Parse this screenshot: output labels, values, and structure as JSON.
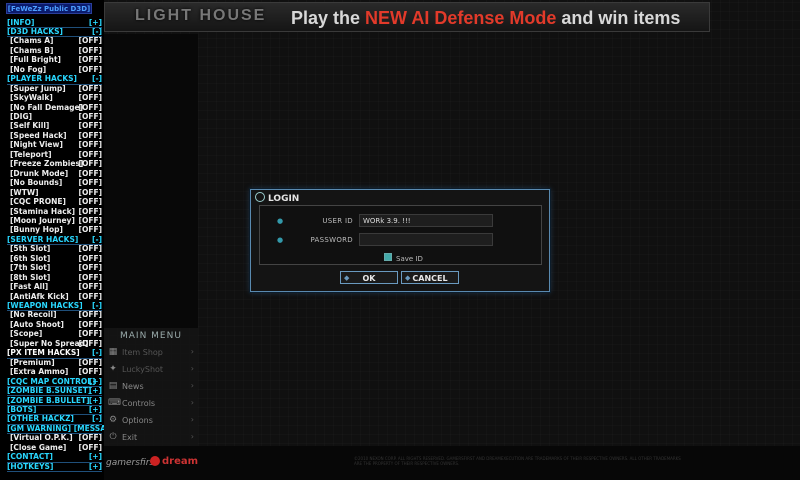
{
  "banner": {
    "logo_text": "LIGHT HOUSE",
    "text_pre": "Play the ",
    "text_hl": "NEW AI Defense Mode",
    "text_post": " and win items"
  },
  "cheat_menu": {
    "title": "[FeWeZz Public D3D]",
    "rows": [
      {
        "kind": "sec",
        "label": "[INFO]",
        "state": "[+]"
      },
      {
        "kind": "sec",
        "label": "[D3D HACKS]",
        "state": "[-]"
      },
      {
        "kind": "item",
        "label": "[Chams A]",
        "state": "[OFF]"
      },
      {
        "kind": "item",
        "label": "[Chams B]",
        "state": "[OFF]"
      },
      {
        "kind": "item",
        "label": "[Full Bright]",
        "state": "[OFF]"
      },
      {
        "kind": "item",
        "label": "[No Fog]",
        "state": "[OFF]"
      },
      {
        "kind": "sec",
        "label": "[PLAYER HACKS]",
        "state": "[-]"
      },
      {
        "kind": "item",
        "label": "[Super Jump]",
        "state": "[OFF]"
      },
      {
        "kind": "item",
        "label": "[SkyWalk]",
        "state": "[OFF]"
      },
      {
        "kind": "item",
        "label": "[No Fall Demage]",
        "state": "[OFF]"
      },
      {
        "kind": "item",
        "label": "[DIG]",
        "state": "[OFF]"
      },
      {
        "kind": "item",
        "label": "[Self Kill]",
        "state": "[OFF]"
      },
      {
        "kind": "item",
        "label": "[Speed Hack]",
        "state": "[OFF]"
      },
      {
        "kind": "item",
        "label": "[Night View]",
        "state": "[OFF]"
      },
      {
        "kind": "item",
        "label": "[Teleport]",
        "state": "[OFF]"
      },
      {
        "kind": "item",
        "label": "[Freeze Zombies]",
        "state": "[OFF]"
      },
      {
        "kind": "item",
        "label": "[Drunk Mode]",
        "state": "[OFF]"
      },
      {
        "kind": "item",
        "label": "[No Bounds]",
        "state": "[OFF]"
      },
      {
        "kind": "item",
        "label": "[WTW]",
        "state": "[OFF]"
      },
      {
        "kind": "item",
        "label": "[CQC PRONE]",
        "state": "[OFF]"
      },
      {
        "kind": "item",
        "label": "[Stamina Hack]",
        "state": "[OFF]"
      },
      {
        "kind": "item",
        "label": "[Moon Journey]",
        "state": "[OFF]"
      },
      {
        "kind": "item",
        "label": "[Bunny Hop]",
        "state": "[OFF]"
      },
      {
        "kind": "sec",
        "label": "[SERVER HACKS]",
        "state": "[-]"
      },
      {
        "kind": "item",
        "label": "[5th Slot]",
        "state": "[OFF]"
      },
      {
        "kind": "item",
        "label": "[6th Slot]",
        "state": "[OFF]"
      },
      {
        "kind": "item",
        "label": "[7th Slot]",
        "state": "[OFF]"
      },
      {
        "kind": "item",
        "label": "[8th Slot]",
        "state": "[OFF]"
      },
      {
        "kind": "item",
        "label": "[Fast All]",
        "state": "[OFF]"
      },
      {
        "kind": "item",
        "label": "[AntiAfk Kick]",
        "state": "[OFF]"
      },
      {
        "kind": "sec",
        "label": "[WEAPON HACKS]",
        "state": "[-]"
      },
      {
        "kind": "item",
        "label": "[No Recoil]",
        "state": "[OFF]"
      },
      {
        "kind": "item",
        "label": "[Auto Shoot]",
        "state": "[OFF]"
      },
      {
        "kind": "item",
        "label": "[Scope]",
        "state": "[OFF]"
      },
      {
        "kind": "item",
        "label": "[Super No Spread]",
        "state": "[OFF]"
      },
      {
        "kind": "secw",
        "label": "[PX ITEM HACKS]",
        "state": "[-]"
      },
      {
        "kind": "item",
        "label": "[Premium]",
        "state": "[OFF]"
      },
      {
        "kind": "item",
        "label": "[Extra Ammo]",
        "state": "[OFF]"
      },
      {
        "kind": "sec",
        "label": "[CQC MAP CONTROL]",
        "state": "[+]"
      },
      {
        "kind": "sec",
        "label": "[ZOMBIE B.SUNSET]",
        "state": "[+]"
      },
      {
        "kind": "sec",
        "label": "[ZOMBIE B.BULLET]",
        "state": "[+]"
      },
      {
        "kind": "sec",
        "label": "[BOTS]",
        "state": "[+]"
      },
      {
        "kind": "sec",
        "label": "[OTHER HACKZ]",
        "state": "[-]"
      },
      {
        "kind": "sec",
        "label": "[GM WARNING]  [MESSAGE]",
        "state": ""
      },
      {
        "kind": "item",
        "label": "[Virtual O.P.K.]",
        "state": "[OFF]"
      },
      {
        "kind": "item",
        "label": "[Close Game]",
        "state": "[OFF]"
      },
      {
        "kind": "sec",
        "label": "[CONTACT]",
        "state": "[+]"
      },
      {
        "kind": "sec",
        "label": "[HOTKEYS]",
        "state": "[+]"
      }
    ]
  },
  "main_menu": {
    "title": "MAIN MENU",
    "items": [
      {
        "label": "Item Shop",
        "icon": "shop-icon"
      },
      {
        "label": "LuckyShot",
        "icon": "lucky-icon"
      },
      {
        "label": "News",
        "icon": "news-icon"
      },
      {
        "label": "Controls",
        "icon": "controls-icon"
      },
      {
        "label": "Options",
        "icon": "gear-icon"
      },
      {
        "label": "Exit",
        "icon": "power-icon"
      }
    ]
  },
  "login": {
    "title": "LOGIN",
    "user_id_label": "USER ID",
    "user_id_value": "WORk 3.9. !!!",
    "password_label": "PASSWORD",
    "password_value": "",
    "save_id_label": "Save ID",
    "ok_label": "OK",
    "cancel_label": "CANCEL"
  },
  "footer": {
    "gamersfirst": "gamersfirst",
    "dream": "dream",
    "legal": "©2010 NEXON CORP. ALL RIGHTS RESERVED. GAMERSFIRST AND DREAMEXECUTION ARE TRADEMARKS OF THEIR RESPECTIVE OWNERS. ALL OTHER TRADEMARKS ARE THE PROPERTY OF THEIR RESPECTIVE OWNERS."
  }
}
